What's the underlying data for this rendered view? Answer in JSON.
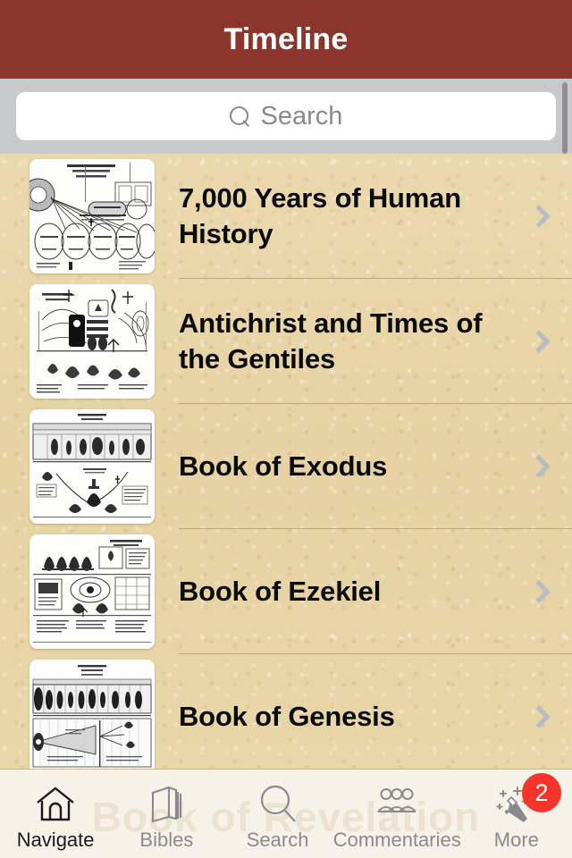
{
  "header": {
    "title": "Timeline"
  },
  "search": {
    "placeholder": "Search",
    "value": "",
    "icon": "search-icon"
  },
  "list": {
    "items": [
      {
        "label": "7,000 Years of Human History",
        "thumbnail": "chart-thumbnail-seven-thousand-years",
        "accessory": "chevron-right-icon"
      },
      {
        "label": "Antichrist and Times of the Gentiles",
        "thumbnail": "chart-thumbnail-antichrist",
        "accessory": "chevron-right-icon"
      },
      {
        "label": "Book of Exodus",
        "thumbnail": "chart-thumbnail-exodus",
        "accessory": "chevron-right-icon"
      },
      {
        "label": "Book of Ezekiel",
        "thumbnail": "chart-thumbnail-ezekiel",
        "accessory": "chevron-right-icon"
      },
      {
        "label": "Book of Genesis",
        "thumbnail": "chart-thumbnail-genesis",
        "accessory": "chevron-right-icon"
      }
    ]
  },
  "tab_bar": {
    "watermark": "Book of Revelation",
    "tabs": [
      {
        "label": "Navigate",
        "icon": "home-icon",
        "active": true,
        "badge": ""
      },
      {
        "label": "Bibles",
        "icon": "book-icon",
        "active": false,
        "badge": ""
      },
      {
        "label": "Search",
        "icon": "search-icon",
        "active": false,
        "badge": ""
      },
      {
        "label": "Commentaries",
        "icon": "people-group-icon",
        "active": false,
        "badge": ""
      },
      {
        "label": "More",
        "icon": "magic-wand-icon",
        "active": false,
        "badge": "2"
      }
    ]
  },
  "colors": {
    "header_background": "#8C352C",
    "header_text": "#FFFFFF",
    "search_bar_background": "#C8C9CB",
    "search_field_background": "#FFFFFF",
    "parchment": "#E8D5A8",
    "row_separator": "#C89A62",
    "chevron": "#B9BBC0",
    "tab_bar_background": "#F7F2E7",
    "tab_inactive": "#8A8A8E",
    "tab_active": "#1A1A1A",
    "badge_background": "#F5352B",
    "badge_text": "#FFFFFF"
  }
}
